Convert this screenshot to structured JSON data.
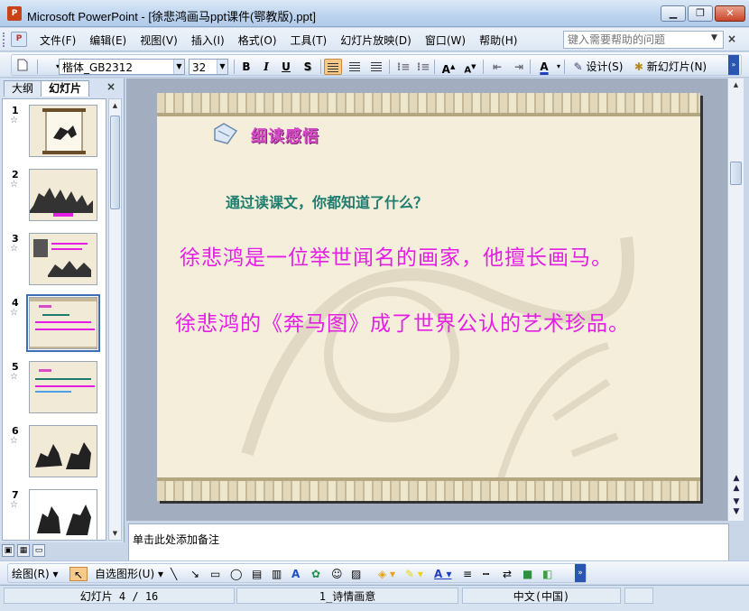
{
  "window": {
    "title": "Microsoft PowerPoint - [徐悲鸿画马ppt课件(鄂教版).ppt]",
    "app_icon_text": "P",
    "controls": [
      "minimize",
      "restore",
      "close"
    ]
  },
  "menu": {
    "items": [
      "文件(F)",
      "编辑(E)",
      "视图(V)",
      "插入(I)",
      "格式(O)",
      "工具(T)",
      "幻灯片放映(D)",
      "窗口(W)",
      "帮助(H)"
    ],
    "help_placeholder": "键入需要帮助的问题",
    "close_glyph": "×"
  },
  "toolbar": {
    "font_name": "楷体_GB2312",
    "font_size": "32",
    "bold": "B",
    "italic": "I",
    "underline": "U",
    "shadow": "S",
    "design_label": "设计(S)",
    "new_slide_label": "新幻灯片(N)",
    "font_color_glyph": "A"
  },
  "left_pane": {
    "tabs": [
      "大纲",
      "幻灯片"
    ],
    "active_tab": "幻灯片",
    "close_glyph": "×",
    "thumbnails": [
      {
        "num": "1"
      },
      {
        "num": "2"
      },
      {
        "num": "3"
      },
      {
        "num": "4"
      },
      {
        "num": "5"
      },
      {
        "num": "6"
      },
      {
        "num": "7"
      }
    ],
    "selected": "4"
  },
  "slide": {
    "heading": "细读感悟",
    "question": "通过读课文，你都知道了什么？",
    "line1": "徐悲鸿是一位举世闻名的画家，他擅长画马。",
    "line2": "徐悲鸿的《奔马图》成了世界公认的艺术珍品。",
    "colors": {
      "heading": "#d84bc7",
      "question": "#1e7d6e",
      "body": "#e51ee5",
      "background": "#f4eedb"
    }
  },
  "notes": {
    "placeholder": "单击此处添加备注"
  },
  "drawing_toolbar": {
    "draw_label": "绘图(R)",
    "autoshapes_label": "自选图形(U)"
  },
  "status": {
    "slide_info": "幻灯片 4 / 16",
    "design": "1_诗情画意",
    "language": "中文(中国)"
  }
}
